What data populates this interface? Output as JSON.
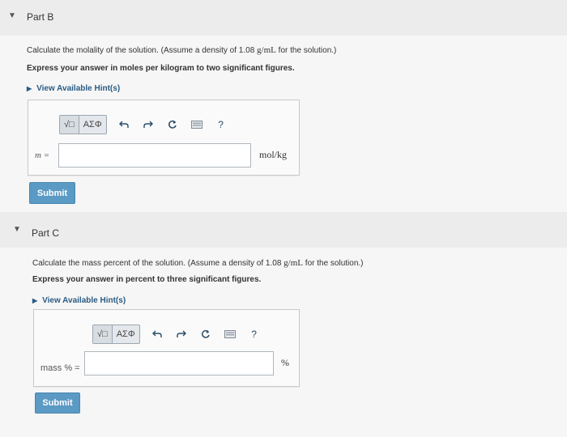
{
  "part_b": {
    "title": "Part B",
    "question_prefix": "Calculate the molality of the solution. (Assume a density of 1.08 ",
    "question_unit": "g/mL",
    "question_suffix": " for the solution.)",
    "instruction": "Express your answer in moles per kilogram to two significant figures.",
    "hint_label": "View Available Hint(s)",
    "answer_label": "m =",
    "answer_value": "",
    "unit": "mol/kg",
    "submit_label": "Submit"
  },
  "part_c": {
    "title": "Part C",
    "question_prefix": "Calculate the mass percent of the solution. (Assume a density of 1.08 ",
    "question_unit": "g/mL",
    "question_suffix": " for the solution.)",
    "instruction": "Express your answer in percent to three significant figures.",
    "hint_label": "View Available Hint(s)",
    "answer_label": "mass % =",
    "answer_value": "",
    "unit": "%",
    "submit_label": "Submit"
  },
  "toolbar": {
    "templates_label": "√□",
    "greek_label": "ΑΣΦ",
    "help_label": "?"
  },
  "icons": [
    "caret-down-icon",
    "caret-right-icon",
    "templates-icon",
    "greek-symbols-icon",
    "undo-icon",
    "redo-icon",
    "reset-icon",
    "keyboard-icon",
    "help-icon"
  ]
}
